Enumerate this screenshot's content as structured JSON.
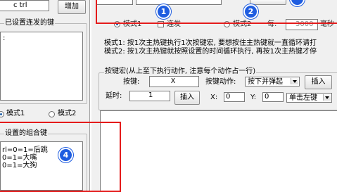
{
  "left": {
    "top_field": "c trl",
    "add_button": "增加",
    "repeat_group_title": "已设置连发的键",
    "repeat_list_text": ":",
    "mode1": "模式1",
    "mode2": "模式2",
    "combo_group_title": "设置的组合键",
    "combo_lines": [
      "rl=0=1=后跳",
      "0=1=大嘴",
      "0=1=大狗"
    ]
  },
  "top": {
    "mode1_label": "模式1",
    "repeat_checkbox_label": "连发",
    "mode2_label": "模式2",
    "every_label": "每:",
    "every_value": "3000",
    "ms_label": "毫秒"
  },
  "desc": {
    "line1": "模式1: 按1次主热键执行1次按键宏, 要想按住主热键就一直循环请打",
    "line2": "模式2: 按1次主热键就按照设置的时间循环执行, 再按1次主热键才停"
  },
  "macro": {
    "group_title": "按键宏(从上至下执行动作, 注意每个动作占一行)",
    "key_label": "按键:",
    "key_value": "X",
    "action_label": "按键动作:",
    "action_value": "按下并弹起",
    "insert_label": "插入",
    "delay_label": "延时:",
    "delay_value": "1",
    "insert2_label": "插入",
    "x_label": "X:",
    "x_value": "0",
    "y_label": "Y:",
    "y_value": "0",
    "click_value": "单击左键"
  },
  "badges": {
    "b1": "1",
    "b2": "2",
    "b4": "4"
  },
  "colors": {
    "highlight_red": "#e41b1b",
    "badge_blue": "#1f5de0"
  }
}
